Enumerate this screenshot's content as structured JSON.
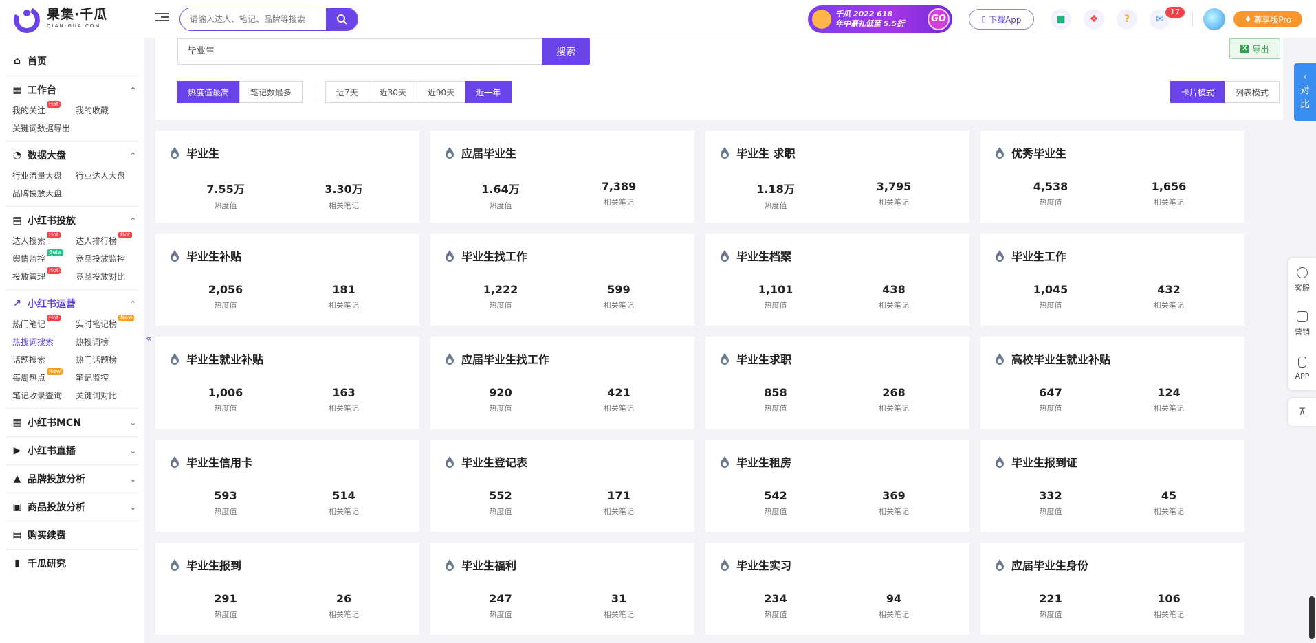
{
  "brand": {
    "name_cn": "果集·千瓜",
    "name_en": "QIAN-GUA.COM"
  },
  "header": {
    "search_placeholder": "请输入达人、笔记、品牌等搜索",
    "promo_line1": "千瓜 2022 618",
    "promo_line2": "年中豪礼低至 5.5折",
    "promo_go": "GO",
    "download_app": "下载App",
    "message_count": "17",
    "pro_button": "尊享版Pro"
  },
  "sidebar": {
    "home": "首页",
    "groups": [
      {
        "title": "工作台",
        "items": [
          {
            "label": "我的关注",
            "tag": "Hot"
          },
          {
            "label": "我的收藏",
            "tag": ""
          },
          {
            "label": "关键词数据导出",
            "tag": ""
          }
        ]
      },
      {
        "title": "数据大盘",
        "items": [
          {
            "label": "行业流量大盘",
            "tag": ""
          },
          {
            "label": "行业达人大盘",
            "tag": ""
          },
          {
            "label": "品牌投放大盘",
            "tag": ""
          }
        ]
      },
      {
        "title": "小红书投放",
        "items": [
          {
            "label": "达人搜索",
            "tag": "Hot"
          },
          {
            "label": "达人排行榜",
            "tag": "Hot"
          },
          {
            "label": "舆情监控",
            "tag": "Beta"
          },
          {
            "label": "竞品投放监控",
            "tag": ""
          },
          {
            "label": "投放管理",
            "tag": "Hot"
          },
          {
            "label": "竞品投放对比",
            "tag": ""
          }
        ]
      },
      {
        "title": "小红书运营",
        "items": [
          {
            "label": "热门笔记",
            "tag": "Hot"
          },
          {
            "label": "实时笔记榜",
            "tag": "New"
          },
          {
            "label": "热搜词搜索",
            "tag": ""
          },
          {
            "label": "热搜词榜",
            "tag": ""
          },
          {
            "label": "话题搜索",
            "tag": ""
          },
          {
            "label": "热门话题榜",
            "tag": ""
          },
          {
            "label": "每周热点",
            "tag": "New"
          },
          {
            "label": "笔记监控",
            "tag": ""
          },
          {
            "label": "笔记收录查询",
            "tag": ""
          },
          {
            "label": "关键词对比",
            "tag": ""
          }
        ]
      }
    ],
    "collapsed": [
      "小红书MCN",
      "小红书直播",
      "品牌投放分析",
      "商品投放分析"
    ],
    "purchase": "购买续费",
    "cut_off": "千瓜研究"
  },
  "filters": {
    "keyword": "毕业生",
    "search_button": "搜索",
    "export_button": "导出",
    "sort_options": [
      "热度值最高",
      "笔记数最多"
    ],
    "range_options": [
      "近7天",
      "近30天",
      "近90天",
      "近一年"
    ],
    "view_options": [
      "卡片模式",
      "列表模式"
    ]
  },
  "stat_labels": {
    "heat": "热度值",
    "notes": "相关笔记"
  },
  "cards": [
    {
      "title": "毕业生",
      "heat": "7.55万",
      "notes": "3.30万"
    },
    {
      "title": "应届毕业生",
      "heat": "1.64万",
      "notes": "7,389"
    },
    {
      "title": "毕业生 求职",
      "heat": "1.18万",
      "notes": "3,795"
    },
    {
      "title": "优秀毕业生",
      "heat": "4,538",
      "notes": "1,656"
    },
    {
      "title": "毕业生补贴",
      "heat": "2,056",
      "notes": "181"
    },
    {
      "title": "毕业生找工作",
      "heat": "1,222",
      "notes": "599"
    },
    {
      "title": "毕业生档案",
      "heat": "1,101",
      "notes": "438"
    },
    {
      "title": "毕业生工作",
      "heat": "1,045",
      "notes": "432"
    },
    {
      "title": "毕业生就业补贴",
      "heat": "1,006",
      "notes": "163"
    },
    {
      "title": "应届毕业生找工作",
      "heat": "920",
      "notes": "421"
    },
    {
      "title": "毕业生求职",
      "heat": "858",
      "notes": "268"
    },
    {
      "title": "高校毕业生就业补贴",
      "heat": "647",
      "notes": "124"
    },
    {
      "title": "毕业生信用卡",
      "heat": "593",
      "notes": "514"
    },
    {
      "title": "毕业生登记表",
      "heat": "552",
      "notes": "171"
    },
    {
      "title": "毕业生租房",
      "heat": "542",
      "notes": "369"
    },
    {
      "title": "毕业生报到证",
      "heat": "332",
      "notes": "45"
    },
    {
      "title": "毕业生报到",
      "heat": "291",
      "notes": "26"
    },
    {
      "title": "毕业生福利",
      "heat": "247",
      "notes": "31"
    },
    {
      "title": "毕业生实习",
      "heat": "234",
      "notes": "94"
    },
    {
      "title": "应届毕业生身份",
      "heat": "221",
      "notes": "106"
    }
  ],
  "right_panel": {
    "compare": "对比",
    "tools": [
      "客服",
      "营销",
      "APP"
    ]
  },
  "colors": {
    "accent": "#6a44e8",
    "compare_tab": "#3a8ef0",
    "pro": "#f9962e",
    "export_green": "#31a24c"
  }
}
